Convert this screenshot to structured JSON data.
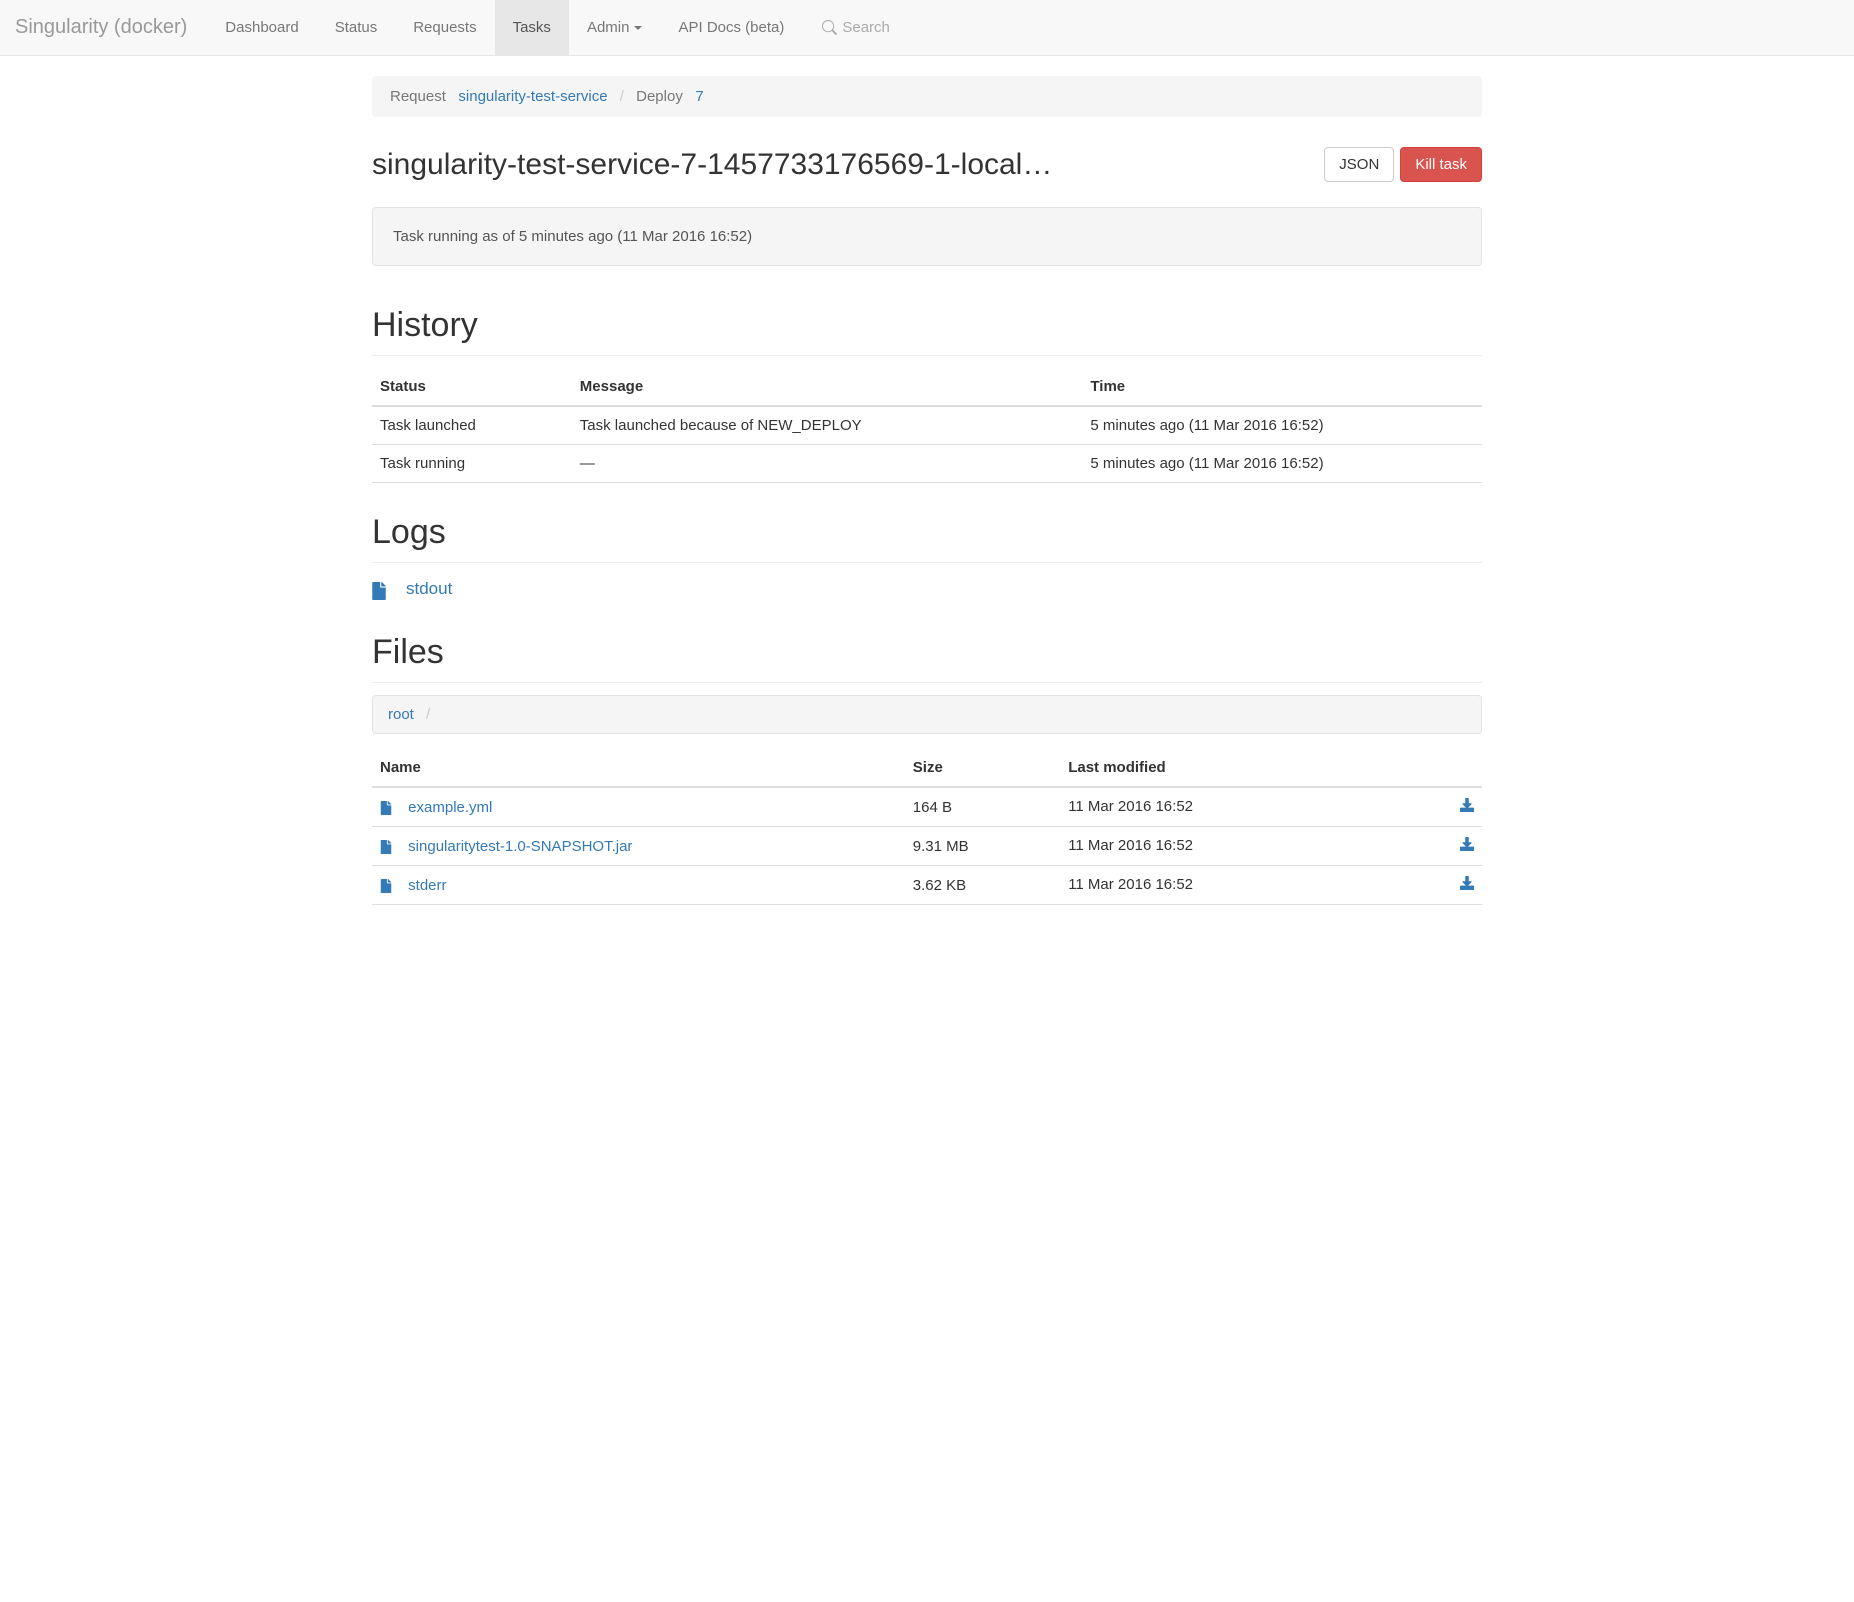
{
  "brand": "Singularity (docker)",
  "nav": {
    "dashboard": "Dashboard",
    "status": "Status",
    "requests": "Requests",
    "tasks": "Tasks",
    "admin": "Admin",
    "apidocs": "API Docs (beta)"
  },
  "search": {
    "placeholder": "Search"
  },
  "breadcrumb": {
    "request_label": "Request",
    "request_link": "singularity-test-service",
    "deploy_label": "Deploy",
    "deploy_link": "7"
  },
  "page": {
    "title": "singularity-test-service-7-1457733176569-1-local…",
    "json_btn": "JSON",
    "kill_btn": "Kill task"
  },
  "status_well": "Task running as of 5 minutes ago (11 Mar 2016 16:52)",
  "sections": {
    "history": "History",
    "logs": "Logs",
    "files": "Files"
  },
  "history": {
    "columns": {
      "status": "Status",
      "message": "Message",
      "time": "Time"
    },
    "rows": [
      {
        "status": "Task launched",
        "message": "Task launched because of NEW_DEPLOY",
        "time": "5 minutes ago (11 Mar 2016 16:52)"
      },
      {
        "status": "Task running",
        "message": "—",
        "time": "5 minutes ago (11 Mar 2016 16:52)"
      }
    ]
  },
  "logs": {
    "items": [
      {
        "name": "stdout"
      }
    ]
  },
  "files": {
    "crumb_root": "root",
    "columns": {
      "name": "Name",
      "size": "Size",
      "modified": "Last modified"
    },
    "rows": [
      {
        "name": "example.yml",
        "size": "164 B",
        "modified": "11 Mar 2016 16:52"
      },
      {
        "name": "singularitytest-1.0-SNAPSHOT.jar",
        "size": "9.31 MB",
        "modified": "11 Mar 2016 16:52"
      },
      {
        "name": "stderr",
        "size": "3.62 KB",
        "modified": "11 Mar 2016 16:52"
      }
    ]
  }
}
